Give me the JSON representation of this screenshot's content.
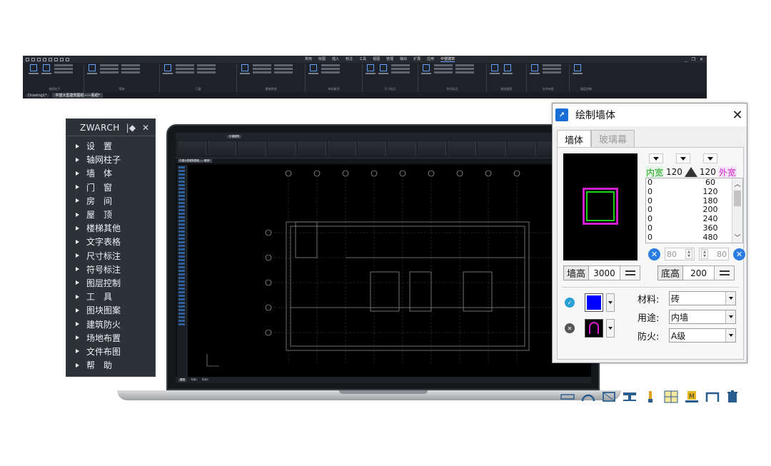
{
  "ribbon": {
    "menus": [
      "常用",
      "绘图",
      "插入",
      "标注",
      "工具",
      "视图",
      "管理",
      "输出",
      "扩展",
      "应用",
      "中望建筑"
    ],
    "active_menu": "中望建筑",
    "window_controls": [
      "_",
      "❐",
      "✕"
    ],
    "group_labels": [
      "轴网柱子",
      "墙体",
      "门窗",
      "楼梯其他",
      "房间屋顶",
      "尺寸标注",
      "符号标注",
      "图块图案",
      "文件布图",
      "图层控制"
    ],
    "doc_tabs": [
      "Drawing1*",
      "中望大型建筑图纸——看纸*"
    ]
  },
  "sidemenu": {
    "title": "ZWARCH",
    "pin_icon": "|◆",
    "close_icon": "✕",
    "items": [
      "设　置",
      "轴网柱子",
      "墙　体",
      "门　窗",
      "房　间",
      "屋　顶",
      "楼梯其他",
      "文字表格",
      "尺寸标注",
      "符号标注",
      "图层控制",
      "工　具",
      "图块图案",
      "建筑防火",
      "场地布置",
      "文件布图",
      "帮　助"
    ]
  },
  "screen": {
    "tab": "中望建筑",
    "doc_tab": "中望大型建筑图纸——看纸*",
    "status_tabs": [
      "模型",
      "布局1",
      "布局2"
    ]
  },
  "dialog": {
    "title": "绘制墙体",
    "tabs": [
      "墙体",
      "玻璃幕"
    ],
    "inner_label": "内宽",
    "inner_value": "120",
    "outer_label": "外宽",
    "outer_value": "120",
    "width_list": [
      {
        "a": "0",
        "b": "60"
      },
      {
        "a": "0",
        "b": "120"
      },
      {
        "a": "0",
        "b": "180"
      },
      {
        "a": "0",
        "b": "200"
      },
      {
        "a": "0",
        "b": "240"
      },
      {
        "a": "0",
        "b": "360"
      },
      {
        "a": "0",
        "b": "480"
      }
    ],
    "left_step": "80",
    "right_step": "80",
    "wall_height_label": "墙高",
    "wall_height": "3000",
    "base_height_label": "底高",
    "base_height": "200",
    "material_label": "材料:",
    "material": "砖",
    "usage_label": "用途:",
    "usage": "内墙",
    "fire_label": "防火:",
    "fire": "A级",
    "colors": {
      "line_color": "#0000ff",
      "accent": "#1a6fd6",
      "check_green": "#1aa51a",
      "inner_green": "#19d219",
      "outer_magenta": "#d21fd2"
    }
  }
}
